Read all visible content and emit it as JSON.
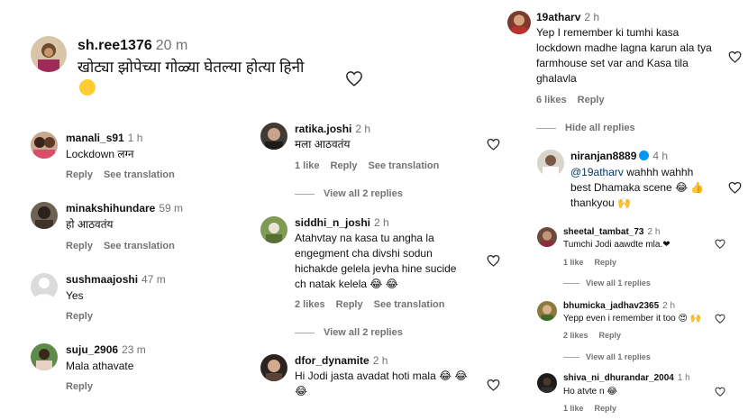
{
  "colors": {
    "text": "#111111",
    "muted": "#737373",
    "heart_stroke": "#262626",
    "mention": "#00376b",
    "heart_red": "#e0245e"
  },
  "main": {
    "username": "sh.ree1376",
    "time": "20 m",
    "text": "खोट्या झोपेच्या गोळ्या घेतल्या होत्या हिनी",
    "emoji": "😂"
  },
  "col1": [
    {
      "username": "manali_s91",
      "time": "1 h",
      "text": "Lockdown लग्न",
      "reply": "Reply",
      "see_translation": "See translation"
    },
    {
      "username": "minakshihundare",
      "time": "59 m",
      "text": "हो आठवतंय",
      "reply": "Reply",
      "see_translation": "See translation"
    },
    {
      "username": "sushmaajoshi",
      "time": "47 m",
      "text": "Yes",
      "reply": "Reply"
    },
    {
      "username": "suju_2906",
      "time": "23 m",
      "text": "Mala athavate",
      "reply": "Reply"
    }
  ],
  "col2": {
    "c1": {
      "username": "ratika.joshi",
      "time": "2 h",
      "text": "मला आठवतंय",
      "likes": "1 like",
      "reply": "Reply",
      "see_translation": "See translation"
    },
    "view1": "View all 2 replies",
    "c2": {
      "username": "siddhi_n_joshi",
      "time": "2 h",
      "text": "Atahvtay na kasa tu angha la engegment cha divshi sodun hichakde gelela jevha hine sucide ch natak kelela 😂 😂",
      "likes": "2 likes",
      "reply": "Reply",
      "see_translation": "See translation"
    },
    "view2": "View all 2 replies",
    "c3": {
      "username": "dfor_dynamite",
      "time": "2 h",
      "text": "Hi Jodi jasta avadat hoti mala 😂 😂 😂"
    }
  },
  "col3": {
    "c1": {
      "username": "19atharv",
      "time": "2 h",
      "text": "Yep I remember ki tumhi kasa lockdown madhe lagna karun ala tya farmhouse set var and Kasa tila ghalavla",
      "likes": "6 likes",
      "reply": "Reply"
    },
    "hide": "Hide all replies",
    "c2": {
      "username": "niranjan8889",
      "time": "4 h",
      "mention": "@19atharv",
      "text": " wahhh wahhh best Dhamaka scene 😂 👍 thankyou 🙌"
    },
    "c3": {
      "username": "sheetal_tambat_73",
      "time": "2 h",
      "text": "Tumchi Jodi aawdte mla.❤",
      "likes": "1 like",
      "reply": "Reply"
    },
    "view1": "View all 1 replies",
    "c4": {
      "username": "bhumicka_jadhav2365",
      "time": "2 h",
      "text": "Yepp even i remember it too 😍 🙌",
      "likes": "2 likes",
      "reply": "Reply"
    },
    "view2": "View all 1 replies",
    "c5": {
      "username": "shiva_ni_dhurandar_2004",
      "time": "1 h",
      "text": "Ho atvte n 😂",
      "likes": "1 like",
      "reply": "Reply"
    }
  }
}
